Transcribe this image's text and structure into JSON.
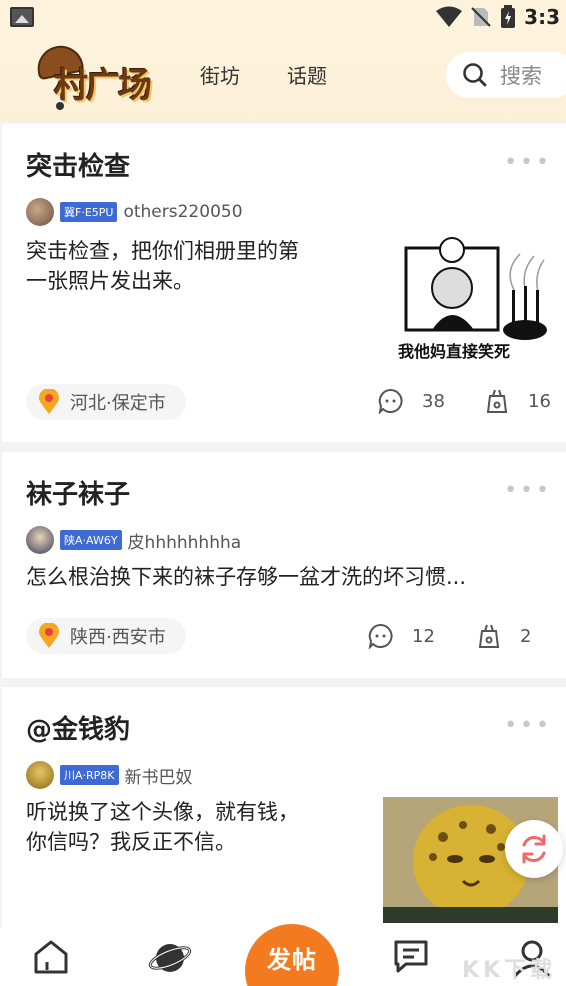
{
  "status_bar": {
    "time": "3:3"
  },
  "header": {
    "logo_text": "村广场",
    "tabs": [
      {
        "label": "街坊"
      },
      {
        "label": "话题"
      }
    ],
    "search_placeholder": "搜索"
  },
  "posts": [
    {
      "title": "突击检查",
      "plate": "冀F·E5PU",
      "author": "others220050",
      "body_lines": [
        "突击检查，把你们相册里的第",
        "一张照片发出来。"
      ],
      "image_caption": "我他妈直接笑死",
      "location": "河北·保定市",
      "comments": "38",
      "likes": "16"
    },
    {
      "title": "袜子袜子",
      "plate": "陕A·AW6Y",
      "author": "皮hhhhhhhha",
      "body_lines": [
        "怎么根治换下来的袜子存够一盆才洗的坏习惯..."
      ],
      "location": "陕西·西安市",
      "comments": "12",
      "likes": "2"
    },
    {
      "title": "@金钱豹",
      "plate": "川A·RP8K",
      "author": "新书巴奴",
      "body_lines": [
        "听说换了这个头像，就有钱，",
        "你信吗？我反正不信。"
      ]
    }
  ],
  "bottom_nav": {
    "post_label": "发帖"
  },
  "watermark": "KK下载",
  "colors": {
    "accent": "#f47a1f",
    "plate_bg": "#3e6ad4",
    "location_pin": "#f5a623"
  }
}
